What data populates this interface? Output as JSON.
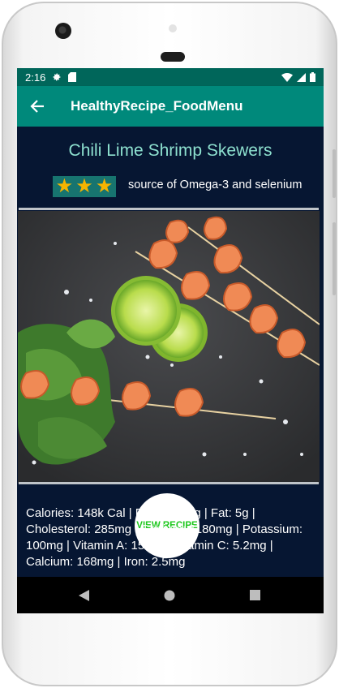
{
  "status_bar": {
    "time": "2:16"
  },
  "app_bar": {
    "title": "HealthyRecipe_FoodMenu",
    "back_icon": "arrow-left-icon"
  },
  "recipe": {
    "title": "Chili Lime Shrimp Skewers",
    "rating_stars": 3,
    "rating_note": "source of Omega-3 and selenium",
    "view_button_label": "VIEW RECIPE",
    "nutrition": "Calories: 148k Cal | Protein: 23g | Fat: 5g | Cholesterol: 285mg | Sodium: 1180mg | Potassium: 100mg | Vitamin A: 150IU | Vitamin C: 5.2mg | Calcium: 168mg | Iron: 2.5mg"
  },
  "colors": {
    "app_bar": "#00897b",
    "status_bar": "#00665a",
    "background": "#061632",
    "title": "#8de0cf",
    "star": "#f6b400",
    "button_text": "#1ec81e"
  }
}
